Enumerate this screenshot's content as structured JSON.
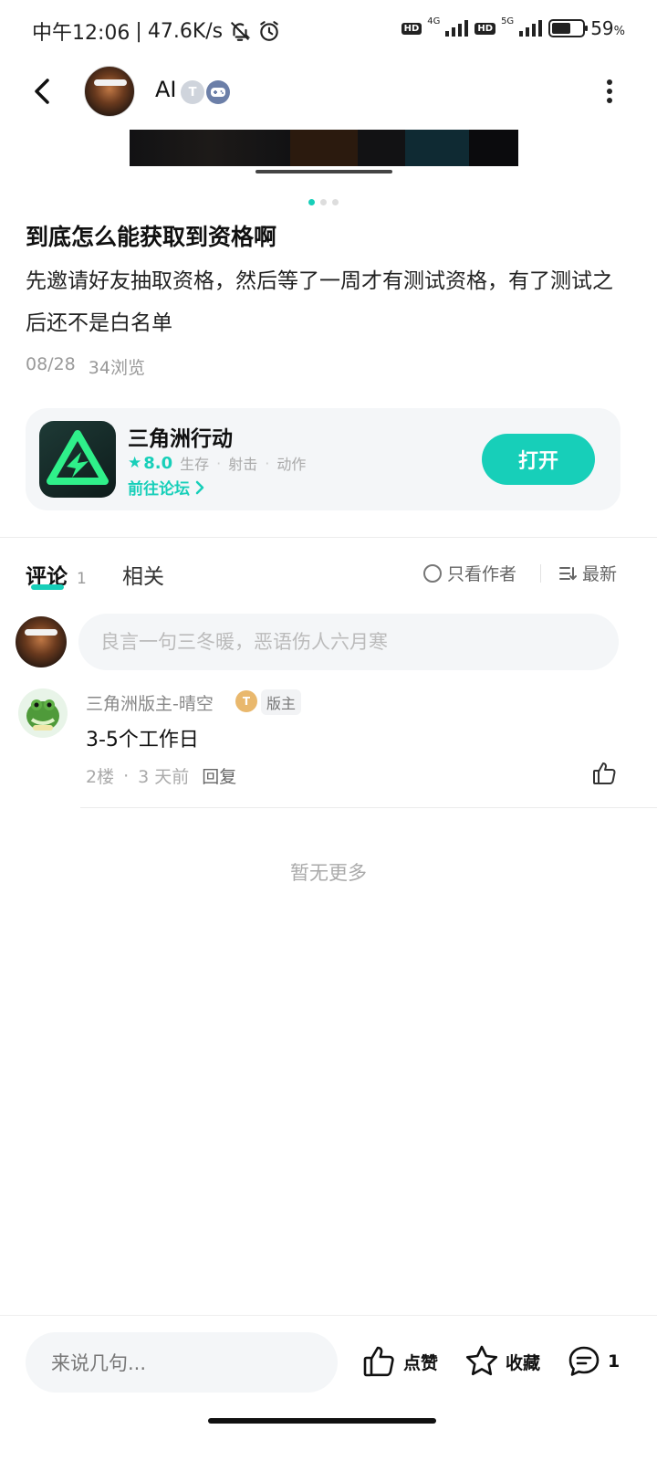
{
  "status_bar": {
    "time": "中午12:06",
    "speed": "47.6K/s",
    "net_label_1": "4G",
    "net_label_2": "5G",
    "hd_label": "HD",
    "battery": "59",
    "battery_unit": "%",
    "battery_level": 0.59
  },
  "header": {
    "author_name": "AI",
    "level_badge": "T",
    "more_icon": "more-vertical-icon",
    "back_icon": "back-arrow-icon"
  },
  "gallery": {
    "page_count": 3,
    "active_index": 0
  },
  "post": {
    "title": "到底怎么能获取到资格啊",
    "body": "先邀请好友抽取资格，然后等了一周才有测试资格，有了测试之后还不是白名单",
    "date": "08/28",
    "views": "34浏览"
  },
  "game_card": {
    "name": "三角洲行动",
    "rating": "8.0",
    "tags": [
      "生存",
      "射击",
      "动作"
    ],
    "tag_sep": "·",
    "forum_link": "前往论坛",
    "open_label": "打开"
  },
  "tabs": {
    "comments_label": "评论",
    "comments_count": "1",
    "related_label": "相关",
    "author_only_label": "只看作者",
    "sort_label": "最新"
  },
  "composer": {
    "placeholder": "良言一句三冬暖，恶语伤人六月寒"
  },
  "comments": [
    {
      "name": "三角洲版主-晴空",
      "level": "T",
      "badge": "版主",
      "text": "3-5个工作日",
      "floor": "2楼",
      "sep": "·",
      "time": "3 天前",
      "reply_label": "回复"
    }
  ],
  "no_more": "暂无更多",
  "bottom_bar": {
    "input_label": "来说几句...",
    "like_label": "点赞",
    "fav_label": "收藏",
    "comment_count": "1"
  },
  "colors": {
    "accent": "#17cfb9",
    "text_primary": "#111111",
    "text_muted": "#999999"
  }
}
